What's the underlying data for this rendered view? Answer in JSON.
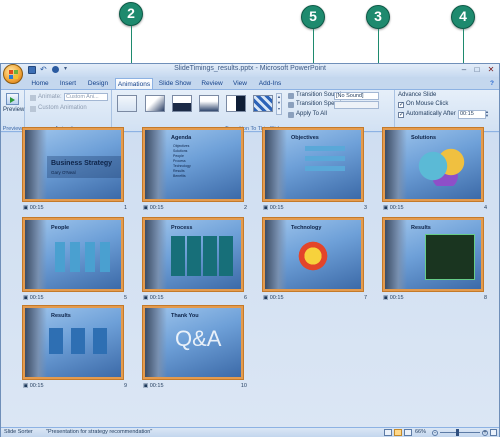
{
  "callouts": [
    "2",
    "5",
    "3",
    "4"
  ],
  "window": {
    "title": "SlideTimings_results.pptx - Microsoft PowerPoint"
  },
  "tabs": [
    "Home",
    "Insert",
    "Design",
    "Animations",
    "Slide Show",
    "Review",
    "View",
    "Add-Ins"
  ],
  "ribbon": {
    "preview": {
      "button": "Preview",
      "group": "Preview"
    },
    "animations": {
      "animate_label": "Animate:",
      "animate_value": "Custom Ani...",
      "custom_animation": "Custom Animation",
      "group": "Animations"
    },
    "transition": {
      "sound_label": "Transition Sound:",
      "sound_value": "[No Sound]",
      "speed_label": "Transition Speed",
      "speed_value": "",
      "apply_all": "Apply To All",
      "group": "Transition To This Slide"
    },
    "advance": {
      "heading": "Advance Slide",
      "on_mouse_click": "On Mouse Click",
      "auto_after": "Automatically After",
      "auto_value": "00:15"
    }
  },
  "slides": [
    {
      "num": "1",
      "time": "00:15",
      "title": "Business Strategy",
      "subtitle": "Gary O'Neal"
    },
    {
      "num": "2",
      "time": "00:15",
      "title": "Agenda",
      "bullets": [
        "Objectives",
        "Solutions",
        "People",
        "Process",
        "Technology",
        "Results",
        "Benefits"
      ]
    },
    {
      "num": "3",
      "time": "00:15",
      "title": "Objectives"
    },
    {
      "num": "4",
      "time": "00:15",
      "title": "Solutions"
    },
    {
      "num": "5",
      "time": "00:15",
      "title": "People"
    },
    {
      "num": "6",
      "time": "00:15",
      "title": "Process"
    },
    {
      "num": "7",
      "time": "00:15",
      "title": "Technology"
    },
    {
      "num": "8",
      "time": "00:15",
      "title": "Results"
    },
    {
      "num": "9",
      "time": "00:15",
      "title": "Results"
    },
    {
      "num": "10",
      "time": "00:15",
      "title": "Thank You",
      "big": "Q&A"
    }
  ],
  "statusbar": {
    "view": "Slide Sorter",
    "theme": "\"Presentation for strategy recommendation\"",
    "zoom": "66%"
  }
}
